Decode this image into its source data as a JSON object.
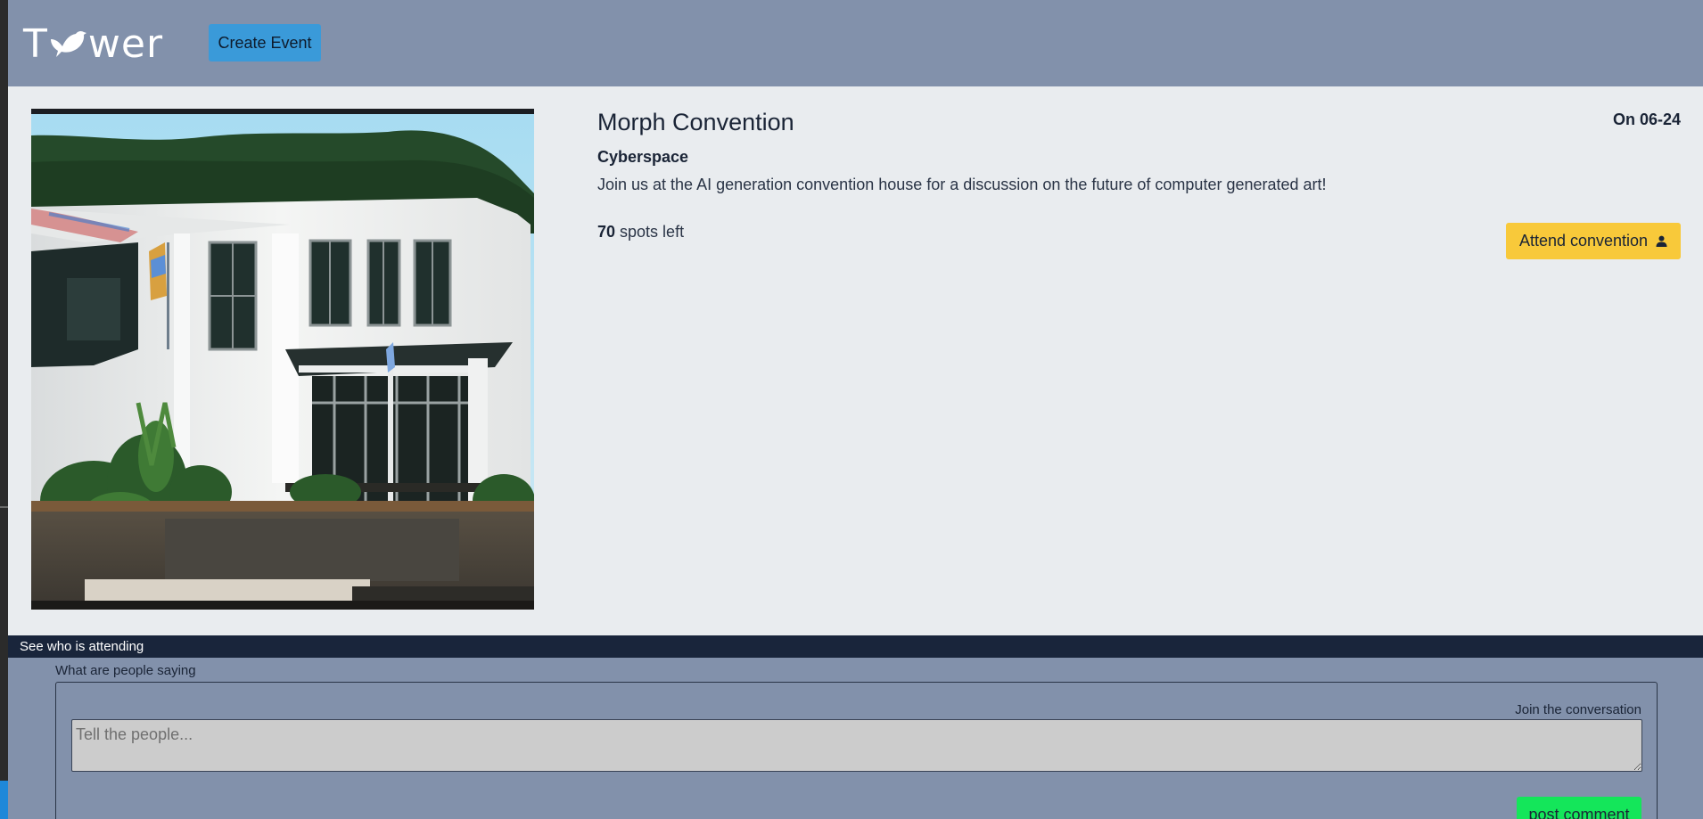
{
  "header": {
    "logo_text_start": "T",
    "logo_text_end": "wer",
    "logo_icon": "bird-icon",
    "create_event_label": "Create Event"
  },
  "event": {
    "title": "Morph Convention",
    "date": "On 06-24",
    "location": "Cyberspace",
    "description": "Join us at the AI generation convention house for a discussion on the future of computer generated art!",
    "spots_count": "70",
    "spots_suffix": " spots left",
    "attend_label": "Attend convention",
    "attend_icon": "person-icon",
    "image_alt": "AI generated photo of a white convention house with plants"
  },
  "attending": {
    "label": "See who is attending"
  },
  "comments": {
    "title": "What are people saying",
    "join_label": "Join the conversation",
    "input_placeholder": "Tell the people...",
    "input_value": "",
    "post_label": "post comment"
  },
  "colors": {
    "header_bg": "#8291ab",
    "card_bg": "#e9ecef",
    "create_button": "#3a9ad9",
    "attend_button": "#f8c93a",
    "attending_bar": "#19253b",
    "post_button": "#14e65a"
  }
}
